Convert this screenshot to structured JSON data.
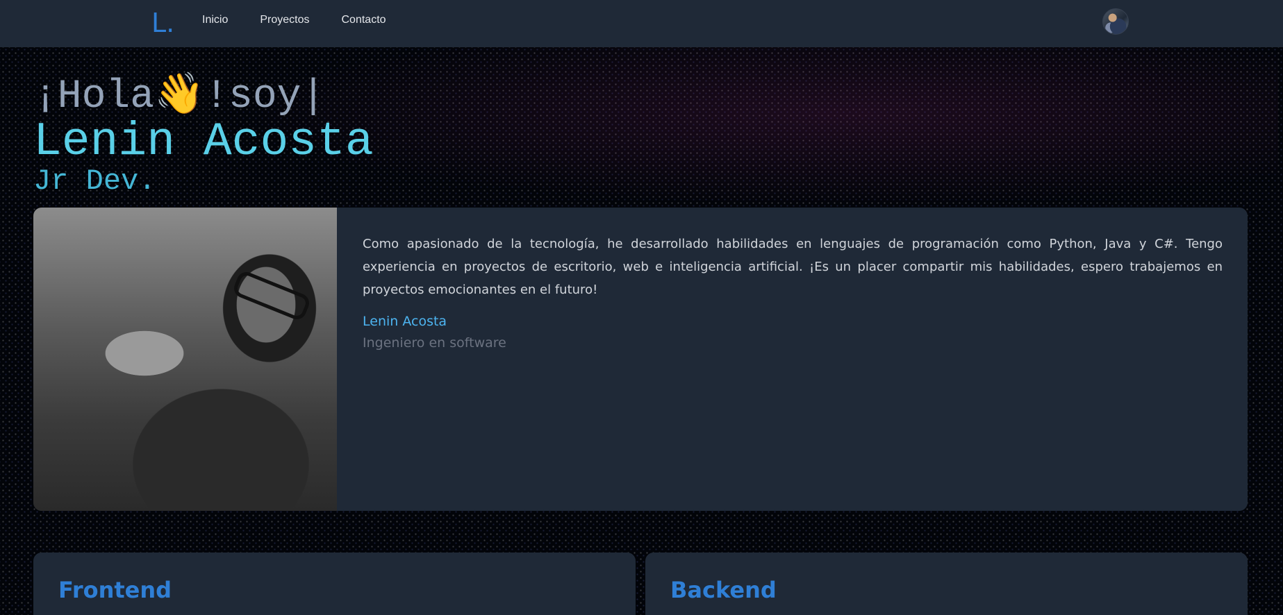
{
  "navbar": {
    "brand": "L",
    "brand_dot": ".",
    "links": [
      "Inicio",
      "Proyectos",
      "Contacto"
    ],
    "avatar_icon": "user-avatar"
  },
  "hero": {
    "greeting": "¡Hola",
    "wave_emoji": "👋",
    "greeting_end": "!soy",
    "cursor": "|",
    "name": "Lenin Acosta",
    "role": "Jr Dev."
  },
  "profile": {
    "bio": "Como apasionado de la tecnología, he desarrollado habilidades en lenguajes de programación como Python, Java y C#. Tengo experiencia en proyectos de escritorio, web e inteligencia artificial. ¡Es un placer compartir mis habilidades, espero trabajemos en proyectos emocionantes en el futuro!",
    "author_name": "Lenin Acosta",
    "author_title": "Ingeniero en software"
  },
  "skills": {
    "frontend_title": "Frontend",
    "backend_title": "Backend"
  },
  "colors": {
    "navbar_bg": "#1f2937",
    "card_bg": "#1f2937",
    "accent_blue": "#2f7fd6",
    "name_cyan": "#5ad0e8",
    "author_blue": "#4db4f0"
  }
}
